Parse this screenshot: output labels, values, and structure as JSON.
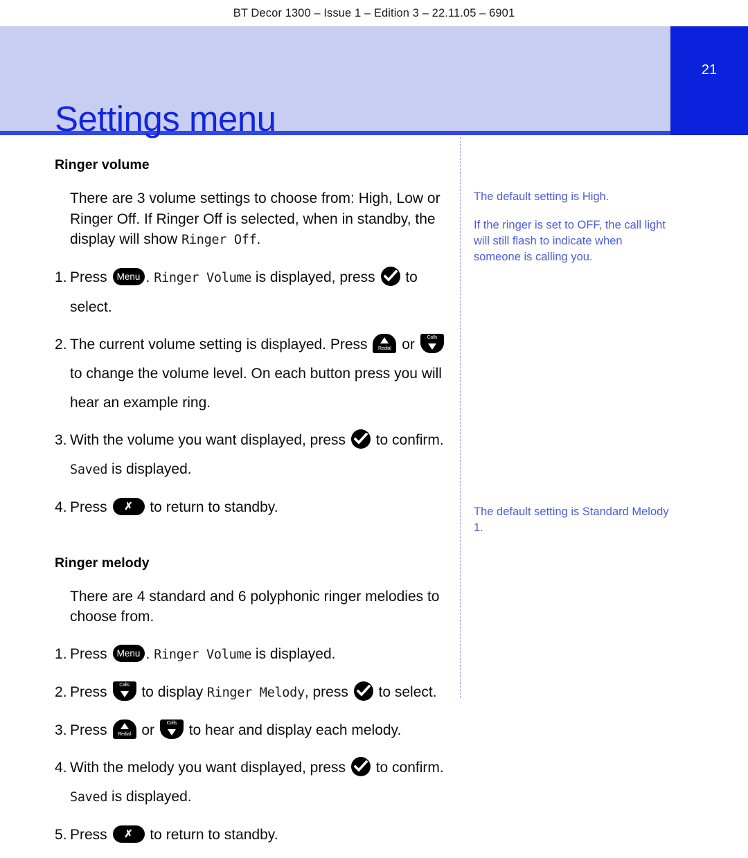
{
  "document": {
    "running_header": "BT Decor 1300 – Issue 1 – Edition 3 – 22.11.05 – 6901",
    "chapter_title": "Settings menu",
    "page_number": "21"
  },
  "keys": {
    "menu_label": "Menu",
    "cancel_label": "✗",
    "ok_label": "ok-check-icon",
    "up_label": "Redial",
    "down_label": "Calls"
  },
  "colors": {
    "banner_bg": "#c8cdf2",
    "banner_rule": "#3348e8",
    "page_tab_bg": "#0a22dc",
    "title_text": "#1226e0",
    "note_text": "#4a5cd8",
    "divider": "#8a93e0"
  },
  "sections": [
    {
      "heading": "Ringer volume",
      "intro_a": "There are 3 volume settings to choose from: High, Low or Ringer Off. If Ringer Off is selected, when in standby, the display will show ",
      "intro_lcd": "Ringer Off",
      "intro_b": ".",
      "steps": {
        "s1_a": "Press ",
        "s1_b": ". ",
        "s1_lcd": "Ringer Volume",
        "s1_c": " is displayed, press ",
        "s1_d": " to select.",
        "s2_a": "The current volume setting is displayed. Press ",
        "s2_b": " or ",
        "s2_c": " to change the volume level. On each button press you will hear an example ring.",
        "s3_a": "With the volume you want displayed, press ",
        "s3_b": " to confirm. ",
        "s3_lcd": "Saved",
        "s3_c": " is displayed.",
        "s4_a": "Press ",
        "s4_b": " to return to standby."
      }
    },
    {
      "heading": "Ringer melody",
      "intro_a": "There are 4 standard and 6 polyphonic ringer melodies to choose from.",
      "steps": {
        "s1_a": "Press ",
        "s1_b": ". ",
        "s1_lcd": "Ringer Volume",
        "s1_c": " is displayed.",
        "s2_a": "Press ",
        "s2_b": " to display ",
        "s2_lcd": "Ringer Melody",
        "s2_c": ", press ",
        "s2_d": " to select.",
        "s3_a": "Press ",
        "s3_b": " or ",
        "s3_c": " to hear and display each melody.",
        "s4_a": "With the melody you want displayed, press ",
        "s4_b": " to confirm. ",
        "s4_lcd": "Saved",
        "s4_c": " is displayed.",
        "s5_a": "Press ",
        "s5_b": " to return to standby."
      }
    }
  ],
  "notes": {
    "volume_1": "The default setting is High.",
    "volume_2": "If the ringer is set to OFF, the call light will still flash to indicate when someone is calling you.",
    "melody_1": "The default setting is Standard Melody 1."
  }
}
